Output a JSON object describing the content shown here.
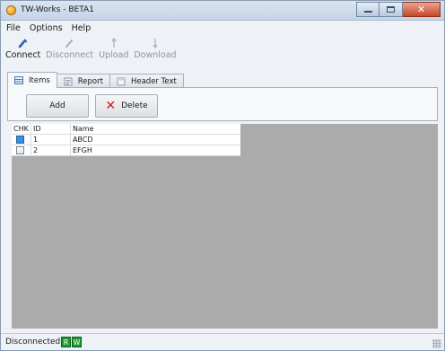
{
  "window": {
    "title": "TW-Works - BETA1"
  },
  "menu": {
    "items": [
      "File",
      "Options",
      "Help"
    ]
  },
  "toolbar": {
    "connect": "Connect",
    "disconnect": "Disconnect",
    "upload": "Upload",
    "download": "Download"
  },
  "tabs": [
    "Items",
    "Report",
    "Header Text"
  ],
  "actions": {
    "add": "Add",
    "delete": "Delete"
  },
  "grid": {
    "columns": [
      "CHK",
      "ID",
      "Name"
    ],
    "rows": [
      {
        "id": "1",
        "name": "ABCD"
      },
      {
        "id": "2",
        "name": "EFGH"
      }
    ]
  },
  "status": {
    "text": "Disconnected",
    "r": "R",
    "w": "W"
  },
  "colors": {
    "grid_background": "#ababab",
    "indicator": "#1f9a2e",
    "delete_icon": "#d11b1b"
  }
}
